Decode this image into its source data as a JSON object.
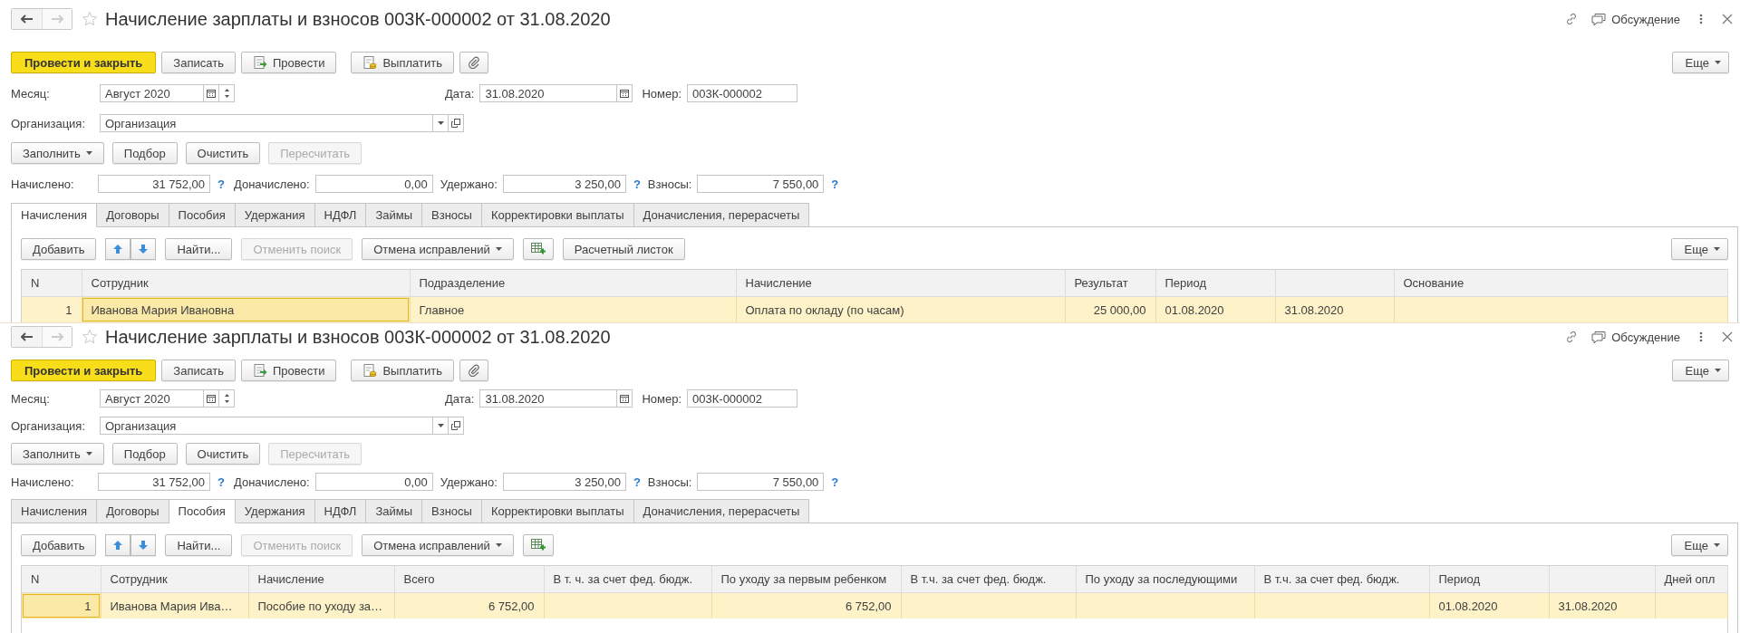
{
  "windows": [
    {
      "title": "Начисление зарплаты и взносов 003К-000002 от 31.08.2020",
      "discussion": "Обсуждение",
      "more": "Еще",
      "commands": [
        {
          "kind": "primary",
          "label": "Провести и закрыть"
        },
        {
          "kind": "plain",
          "label": "Записать"
        },
        {
          "kind": "post",
          "label": "Провести"
        },
        {
          "kind": "pay",
          "label": "Выплатить"
        },
        {
          "kind": "attach"
        }
      ],
      "month": {
        "label": "Месяц:",
        "value": "Август 2020"
      },
      "date": {
        "label": "Дата:",
        "value": "31.08.2020"
      },
      "number": {
        "label": "Номер:",
        "value": "003К-000002"
      },
      "organization": {
        "label": "Организация:",
        "value": "Организация"
      },
      "fill_buttons": [
        {
          "label": "Заполнить",
          "dropdown": true,
          "disabled": false
        },
        {
          "label": "Подбор",
          "dropdown": false,
          "disabled": false
        },
        {
          "label": "Очистить",
          "dropdown": false,
          "disabled": false
        },
        {
          "label": "Пересчитать",
          "dropdown": false,
          "disabled": true
        }
      ],
      "totals": [
        {
          "label": "Начислено:",
          "value": "31 752,00",
          "hint": "?"
        },
        {
          "label": "Доначислено:",
          "value": "0,00"
        },
        {
          "label": "Удержано:",
          "value": "3 250,00",
          "hint": "?"
        },
        {
          "label": "Взносы:",
          "value": "7 550,00",
          "hint": "?"
        }
      ],
      "tabs": [
        {
          "label": "Начисления",
          "selected": true
        },
        {
          "label": "Договоры",
          "selected": false
        },
        {
          "label": "Пособия",
          "selected": false
        },
        {
          "label": "Удержания",
          "selected": false
        },
        {
          "label": "НДФЛ",
          "selected": false
        },
        {
          "label": "Займы",
          "selected": false
        },
        {
          "label": "Взносы",
          "selected": false
        },
        {
          "label": "Корректировки выплаты",
          "selected": false
        },
        {
          "label": "Доначисления, перерасчеты",
          "selected": false
        }
      ],
      "table_toolbar": [
        {
          "kind": "text",
          "label": "Добавить",
          "disabled": false,
          "dropdown": false
        },
        {
          "kind": "arrows"
        },
        {
          "kind": "text",
          "label": "Найти...",
          "disabled": false,
          "dropdown": false
        },
        {
          "kind": "text",
          "label": "Отменить поиск",
          "disabled": true,
          "dropdown": false
        },
        {
          "kind": "text",
          "label": "Отмена исправлений",
          "disabled": false,
          "dropdown": true
        },
        {
          "kind": "grid"
        },
        {
          "kind": "text",
          "label": "Расчетный листок",
          "disabled": false,
          "dropdown": false
        }
      ],
      "table_more": "Еще",
      "table": {
        "columns": [
          {
            "label": "N",
            "kind": "number"
          },
          {
            "label": "Сотрудник",
            "kind": "text"
          },
          {
            "label": "Подразделение",
            "kind": "text"
          },
          {
            "label": "Начисление",
            "kind": "text"
          },
          {
            "label": "Результат",
            "kind": "number"
          },
          {
            "label": "Период",
            "kind": "text"
          },
          {
            "kind": "text"
          },
          {
            "label": "Основание",
            "kind": "text"
          }
        ],
        "rows": [
          {
            "selected": true,
            "cells": [
              {
                "text": "1",
                "focused": false
              },
              {
                "text": "Иванова Мария Ивановна",
                "focused": true
              },
              {
                "text": "Главное",
                "focused": false
              },
              {
                "text": "Оплата по окладу (по часам)",
                "focused": false
              },
              {
                "text": "25 000,00",
                "focused": false
              },
              {
                "text": "01.08.2020",
                "focused": false
              },
              {
                "text": "31.08.2020",
                "focused": false
              },
              {
                "focused": false
              }
            ]
          }
        ]
      }
    },
    {
      "title": "Начисление зарплаты и взносов 003К-000002 от 31.08.2020",
      "discussion": "Обсуждение",
      "more": "Еще",
      "commands": [
        {
          "kind": "primary",
          "label": "Провести и закрыть"
        },
        {
          "kind": "plain",
          "label": "Записать"
        },
        {
          "kind": "post",
          "label": "Провести"
        },
        {
          "kind": "pay",
          "label": "Выплатить"
        },
        {
          "kind": "attach"
        }
      ],
      "month": {
        "label": "Месяц:",
        "value": "Август 2020"
      },
      "date": {
        "label": "Дата:",
        "value": "31.08.2020"
      },
      "number": {
        "label": "Номер:",
        "value": "003К-000002"
      },
      "organization": {
        "label": "Организация:",
        "value": "Организация"
      },
      "fill_buttons": [
        {
          "label": "Заполнить",
          "dropdown": true,
          "disabled": false
        },
        {
          "label": "Подбор",
          "dropdown": false,
          "disabled": false
        },
        {
          "label": "Очистить",
          "dropdown": false,
          "disabled": false
        },
        {
          "label": "Пересчитать",
          "dropdown": false,
          "disabled": true
        }
      ],
      "totals": [
        {
          "label": "Начислено:",
          "value": "31 752,00",
          "hint": "?"
        },
        {
          "label": "Доначислено:",
          "value": "0,00"
        },
        {
          "label": "Удержано:",
          "value": "3 250,00",
          "hint": "?"
        },
        {
          "label": "Взносы:",
          "value": "7 550,00",
          "hint": "?"
        }
      ],
      "tabs": [
        {
          "label": "Начисления",
          "selected": false
        },
        {
          "label": "Договоры",
          "selected": false
        },
        {
          "label": "Пособия",
          "selected": true
        },
        {
          "label": "Удержания",
          "selected": false
        },
        {
          "label": "НДФЛ",
          "selected": false
        },
        {
          "label": "Займы",
          "selected": false
        },
        {
          "label": "Взносы",
          "selected": false
        },
        {
          "label": "Корректировки выплаты",
          "selected": false
        },
        {
          "label": "Доначисления, перерасчеты",
          "selected": false
        }
      ],
      "table_toolbar": [
        {
          "kind": "text",
          "label": "Добавить",
          "disabled": false,
          "dropdown": false
        },
        {
          "kind": "arrows"
        },
        {
          "kind": "text",
          "label": "Найти...",
          "disabled": false,
          "dropdown": false
        },
        {
          "kind": "text",
          "label": "Отменить поиск",
          "disabled": true,
          "dropdown": false
        },
        {
          "kind": "text",
          "label": "Отмена исправлений",
          "disabled": false,
          "dropdown": true
        },
        {
          "kind": "grid"
        }
      ],
      "table_more": "Еще",
      "table": {
        "columns": [
          {
            "label": "N",
            "kind": "number"
          },
          {
            "label": "Сотрудник",
            "kind": "text"
          },
          {
            "label": "Начисление",
            "kind": "text"
          },
          {
            "label": "Всего",
            "kind": "number"
          },
          {
            "label": "В т. ч. за счет фед. бюдж.",
            "kind": "number"
          },
          {
            "label": "По уходу за первым ребенком",
            "kind": "number"
          },
          {
            "label": "В т.ч. за счет фед. бюдж.",
            "kind": "number"
          },
          {
            "label": "По уходу за последующими",
            "kind": "number"
          },
          {
            "label": "В т.ч. за счет фед. бюдж.",
            "kind": "number"
          },
          {
            "label": "Период",
            "kind": "text"
          },
          {
            "kind": "text"
          },
          {
            "label": "Дней опл",
            "kind": "number"
          }
        ],
        "rows": [
          {
            "selected": true,
            "cells": [
              {
                "text": "1",
                "focused": true
              },
              {
                "text": "Иванова Мария Ива…",
                "focused": false
              },
              {
                "text": "Пособие по уходу за…",
                "focused": false
              },
              {
                "text": "6 752,00",
                "focused": false
              },
              {
                "focused": false
              },
              {
                "text": "6 752,00",
                "focused": false
              },
              {
                "focused": false
              },
              {
                "focused": false
              },
              {
                "focused": false
              },
              {
                "text": "01.08.2020",
                "focused": false
              },
              {
                "text": "31.08.2020",
                "focused": false
              },
              {
                "focused": false
              }
            ]
          }
        ]
      }
    }
  ]
}
